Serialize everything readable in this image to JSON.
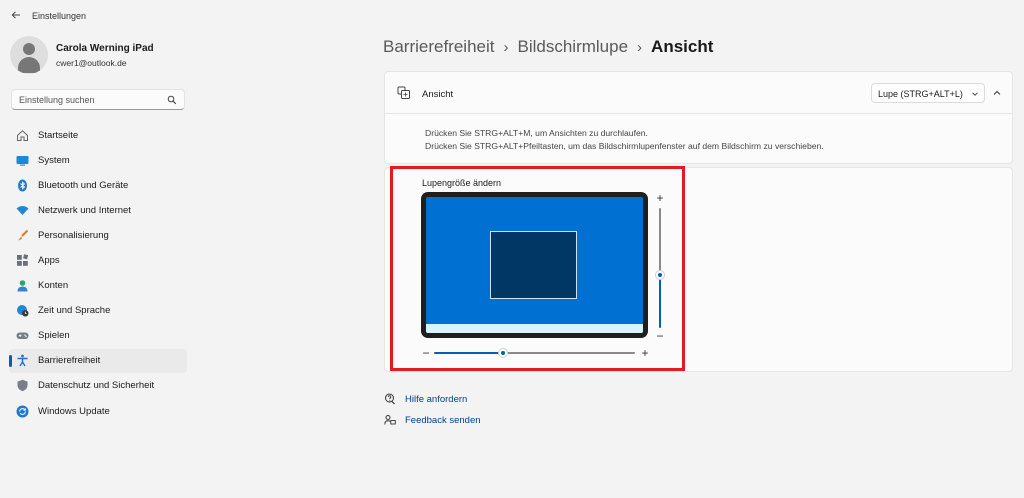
{
  "window": {
    "title": "Einstellungen"
  },
  "profile": {
    "name": "Carola Werning iPad",
    "email": "cwer1@outlook.de"
  },
  "search": {
    "placeholder": "Einstellung suchen"
  },
  "sidebar": {
    "items": [
      {
        "label": "Startseite",
        "icon": "home-icon"
      },
      {
        "label": "System",
        "icon": "system-icon"
      },
      {
        "label": "Bluetooth und Geräte",
        "icon": "bluetooth-icon"
      },
      {
        "label": "Netzwerk und Internet",
        "icon": "wifi-icon"
      },
      {
        "label": "Personalisierung",
        "icon": "brush-icon"
      },
      {
        "label": "Apps",
        "icon": "apps-icon"
      },
      {
        "label": "Konten",
        "icon": "accounts-icon"
      },
      {
        "label": "Zeit und Sprache",
        "icon": "globe-clock-icon"
      },
      {
        "label": "Spielen",
        "icon": "gamepad-icon"
      },
      {
        "label": "Barrierefreiheit",
        "icon": "accessibility-icon",
        "active": true
      },
      {
        "label": "Datenschutz und Sicherheit",
        "icon": "shield-icon"
      },
      {
        "label": "Windows Update",
        "icon": "update-icon"
      }
    ]
  },
  "breadcrumb": {
    "level1": "Barrierefreiheit",
    "level2": "Bildschirmlupe",
    "current": "Ansicht",
    "separator": "›"
  },
  "view_setting": {
    "label": "Ansicht",
    "selected": "Lupe (STRG+ALT+L)",
    "description_line1": "Drücken Sie STRG+ALT+M, um Ansichten zu durchlaufen.",
    "description_line2": "Drücken Sie STRG+ALT+Pfeiltasten, um das Bildschirmlupenfenster auf dem Bildschirm zu verschieben."
  },
  "lens_size": {
    "title": "Lupengröße ändern",
    "width_level": 0.34,
    "height_level": 0.45,
    "plus": "+",
    "minus": "−"
  },
  "links": {
    "help": "Hilfe anfordern",
    "feedback": "Feedback senden"
  },
  "colors": {
    "accent": "#005fb8",
    "highlight_border": "#e01b24",
    "screen": "#0071d3",
    "lens": "#003764"
  }
}
